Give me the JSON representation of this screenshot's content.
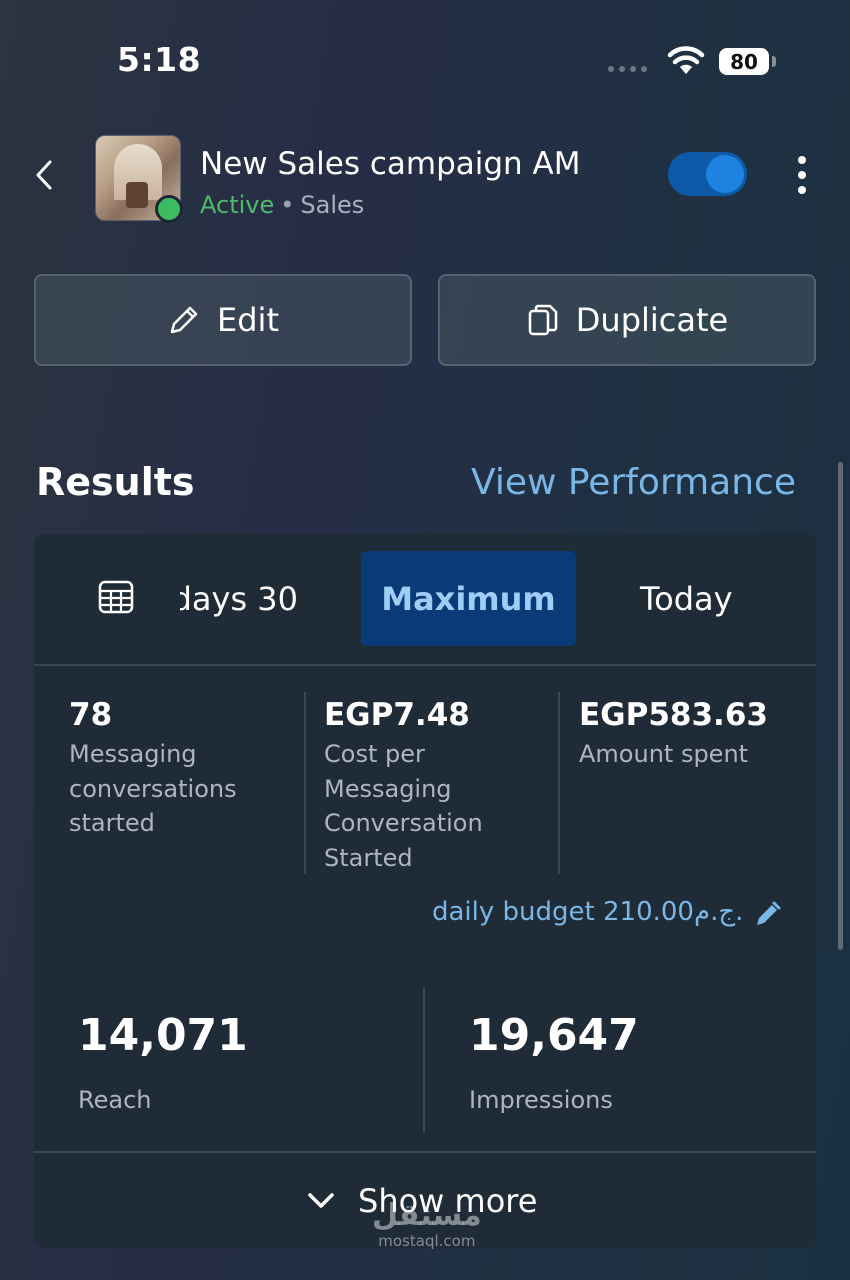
{
  "status_bar": {
    "time": "5:18",
    "battery": "80"
  },
  "header": {
    "title": "New Sales campaign AM",
    "status": "Active",
    "separator": "•",
    "objective": "Sales",
    "toggle_on": true
  },
  "actions": {
    "edit_label": "Edit",
    "duplicate_label": "Duplicate"
  },
  "results": {
    "title": "Results",
    "view_performance": "View Performance",
    "tabs": [
      {
        "label": "30 days",
        "selected": false
      },
      {
        "label": "Maximum",
        "selected": true
      },
      {
        "label": "Today",
        "selected": false
      }
    ],
    "metrics": [
      {
        "value": "78",
        "label": "Messaging conversations started"
      },
      {
        "value": "EGP7.48",
        "label": "Cost per Messaging Conversation Started"
      },
      {
        "value": "EGP583.63",
        "label": "Amount spent"
      }
    ],
    "budget": "daily budget 210.00ج.م.",
    "summary": [
      {
        "value": "14,071",
        "label": "Reach"
      },
      {
        "value": "19,647",
        "label": "Impressions"
      }
    ],
    "show_more": "Show more"
  },
  "watermark": {
    "logo": "مستقل",
    "url": "mostaql.com"
  },
  "colors": {
    "accent": "#7ab7e6",
    "active": "#4cba6a",
    "toggle": "#0e5aa8",
    "selected_tab": "#093b78"
  }
}
